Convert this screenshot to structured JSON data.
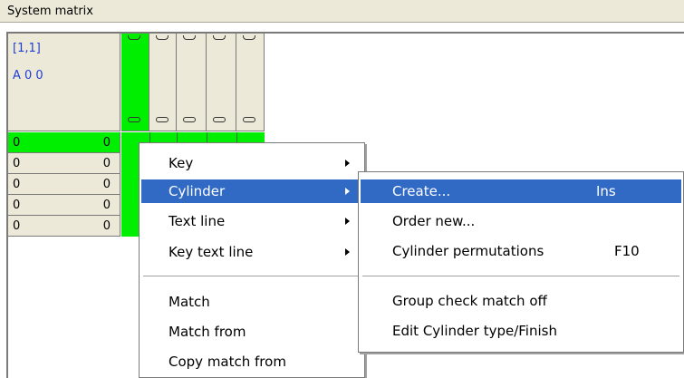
{
  "window": {
    "title": "System matrix"
  },
  "corner": {
    "position": "[1,1]",
    "code": "A 0 0"
  },
  "rows": [
    {
      "left": "0",
      "right": "0"
    },
    {
      "left": "0",
      "right": "0"
    },
    {
      "left": "0",
      "right": "0"
    },
    {
      "left": "0",
      "right": "0"
    },
    {
      "left": "0",
      "right": "0"
    }
  ],
  "context_menu": {
    "items": [
      "Key",
      "Cylinder",
      "Text line",
      "Key text line",
      "Match",
      "Match from",
      "Copy match from"
    ]
  },
  "submenu": {
    "create": {
      "label": "Create...",
      "shortcut": "Ins"
    },
    "order_new": {
      "label": "Order new..."
    },
    "permutations": {
      "label": "Cylinder permutations",
      "shortcut": "F10"
    },
    "group_check": {
      "label": "Group check match off"
    },
    "edit_type": {
      "label": "Edit Cylinder type/Finish"
    }
  },
  "colors": {
    "selected_green": "#00ee00",
    "menu_highlight": "#316ac5",
    "corner_text": "#1e3ed8"
  }
}
